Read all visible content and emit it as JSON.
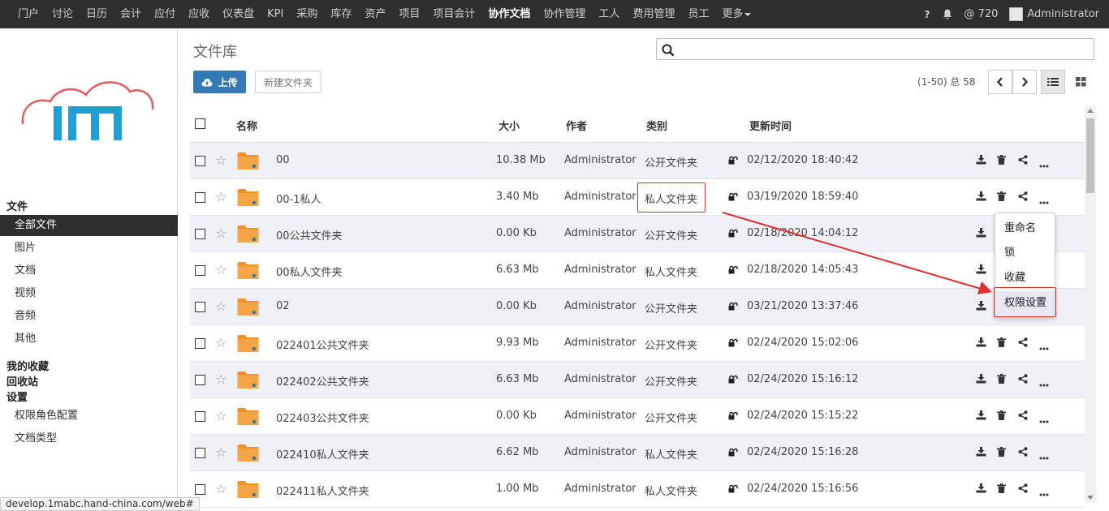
{
  "nav": {
    "items": [
      "门户",
      "讨论",
      "日历",
      "会计",
      "应付",
      "应收",
      "仪表盘",
      "KPI",
      "采购",
      "库存",
      "资产",
      "项目",
      "项目会计",
      "协作文档",
      "协作管理",
      "工人",
      "费用管理",
      "员工",
      "更多"
    ],
    "active": "协作文档",
    "help": "?",
    "mentions": "@ 720",
    "user": "Administrator"
  },
  "sidebar": {
    "sections": {
      "files": "文件",
      "favorites": "我的收藏",
      "recycle": "回收站",
      "settings": "设置"
    },
    "file_items": [
      "全部文件",
      "图片",
      "文档",
      "视频",
      "音频",
      "其他"
    ],
    "setting_items": [
      "权限角色配置",
      "文档类型"
    ]
  },
  "page": {
    "title": "文件库",
    "upload_label": "上传",
    "new_folder_label": "新建文件夹",
    "pager": "(1-50) 总 58"
  },
  "table": {
    "headers": {
      "name": "名称",
      "size": "大小",
      "author": "作者",
      "category": "类别",
      "updated": "更新时间"
    },
    "rows": [
      {
        "name": "00",
        "size": "10.38 Mb",
        "author": "Administrator",
        "category": "公开文件夹",
        "updated": "02/12/2020 18:40:42"
      },
      {
        "name": "00-1私人",
        "size": "3.40 Mb",
        "author": "Administrator",
        "category": "私人文件夹",
        "updated": "03/19/2020 18:59:40"
      },
      {
        "name": "00公共文件夹",
        "size": "0.00 Kb",
        "author": "Administrator",
        "category": "公开文件夹",
        "updated": "02/18/2020 14:04:12"
      },
      {
        "name": "00私人文件夹",
        "size": "6.63 Mb",
        "author": "Administrator",
        "category": "私人文件夹",
        "updated": "02/18/2020 14:05:43"
      },
      {
        "name": "02",
        "size": "0.00 Kb",
        "author": "Administrator",
        "category": "公开文件夹",
        "updated": "03/21/2020 13:37:46"
      },
      {
        "name": "022401公共文件夹",
        "size": "9.93 Mb",
        "author": "Administrator",
        "category": "公开文件夹",
        "updated": "02/24/2020 15:02:06"
      },
      {
        "name": "022402公共文件夹",
        "size": "6.63 Mb",
        "author": "Administrator",
        "category": "公开文件夹",
        "updated": "02/24/2020 15:16:12"
      },
      {
        "name": "022403公共文件夹",
        "size": "0.00 Kb",
        "author": "Administrator",
        "category": "公开文件夹",
        "updated": "02/24/2020 15:15:22"
      },
      {
        "name": "022410私人文件夹",
        "size": "6.62 Mb",
        "author": "Administrator",
        "category": "私人文件夹",
        "updated": "02/24/2020 15:16:28"
      },
      {
        "name": "022411私人文件夹",
        "size": "1.00 Mb",
        "author": "Administrator",
        "category": "私人文件夹",
        "updated": "02/24/2020 15:16:56"
      }
    ]
  },
  "dropdown": {
    "items": [
      "重命名",
      "锁",
      "收藏",
      "权限设置"
    ],
    "highlighted": "权限设置"
  },
  "status_url": "develop.1mabc.hand-china.com/web#",
  "colors": {
    "topbar": "#2f2f2f",
    "primary": "#337ab7",
    "annotation": "#e03030",
    "folder": "#f0922a"
  }
}
